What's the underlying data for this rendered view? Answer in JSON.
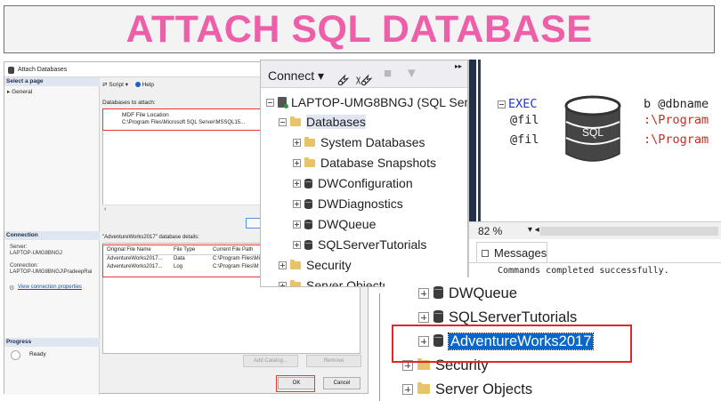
{
  "banner": {
    "title": "ATTACH SQL DATABASE"
  },
  "dialog": {
    "title": "Attach Databases",
    "select_page": "Select a page",
    "general": "General",
    "toolbar_script": "Script",
    "toolbar_help": "Help",
    "databases_to_attach": "Databases to attach:",
    "mdf_header": "MDF File Location",
    "mdf_value": "C:\\Program Files\\Microsoft SQL Server\\MSSQL15...",
    "connection": "Connection",
    "server_label": "Server:",
    "server_value": "LAPTOP-UMG8BNGJ",
    "connection_label": "Connection:",
    "connection_value": "LAPTOP-UMG8BNGJ\\PradeepRai",
    "view_props": "View connection properties",
    "progress": "Progress",
    "ready": "Ready",
    "details_label": "\"AdventureWorks2017\" database details:",
    "details_headers": [
      "Original File Name",
      "File Type",
      "Current File Path"
    ],
    "details_rows": [
      [
        "AdventureWorks2017...",
        "Data",
        "C:\\Program Files\\Mi"
      ],
      [
        "AdventureWorks2017...",
        "Log",
        "C:\\Program Files\\M"
      ]
    ],
    "add_catalog": "Add Catalog...",
    "remove": "Remove",
    "ok": "OK",
    "cancel": "Cancel"
  },
  "explorer": {
    "connect": "Connect",
    "server_node": "LAPTOP-UMG8BNGJ (SQL Serv",
    "databases": "Databases",
    "system_databases": "System Databases",
    "database_snapshots": "Database Snapshots",
    "db1": "DWConfiguration",
    "db2": "DWDiagnostics",
    "db3": "DWQueue",
    "db4": "SQLServerTutorials",
    "security": "Security",
    "server_objects": "Server Objects"
  },
  "query": {
    "line1_kw": "EXEC",
    "line1_rest": "b @dbname",
    "line2_a": "@fil",
    "line2_b": ":\\Program",
    "line3_a": "@fil",
    "line3_b": ":\\Program",
    "icon_text": "SQL",
    "zoom": "82 %",
    "messages_tab": "Messages",
    "messages_output": "Commands completed successfully."
  },
  "zoomed_tree": {
    "dwqueue": "DWQueue",
    "sqlservertutorials": "SQLServerTutorials",
    "adventureworks": "AdventureWorks2017",
    "security": "Security",
    "server_objects": "Server Objects"
  }
}
